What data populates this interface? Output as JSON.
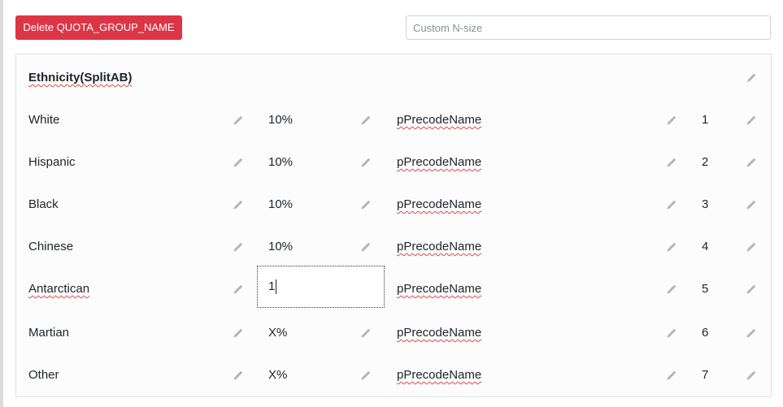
{
  "toolbar": {
    "delete_label": "Delete QUOTA_GROUP_NAME",
    "nsize_placeholder": "Custom N-size",
    "nsize_value": ""
  },
  "group": {
    "title": "Ethnicity(SplitAB)"
  },
  "rows": [
    {
      "name": "White",
      "percent": "10%",
      "precode": "pPrecodeName",
      "index": "1"
    },
    {
      "name": "Hispanic",
      "percent": "10%",
      "precode": "pPrecodeName",
      "index": "2"
    },
    {
      "name": "Black",
      "percent": "10%",
      "precode": "pPrecodeName",
      "index": "3"
    },
    {
      "name": "Chinese",
      "percent": "10%",
      "precode": "pPrecodeName",
      "index": "4"
    },
    {
      "name": "Antarctican",
      "percent": "1",
      "precode": "pPrecodeName",
      "index": "5",
      "editing": true
    },
    {
      "name": "Martian",
      "percent": "X%",
      "precode": "pPrecodeName",
      "index": "6"
    },
    {
      "name": "Other",
      "percent": "X%",
      "precode": "pPrecodeName",
      "index": "7"
    }
  ],
  "colors": {
    "danger": "#dc3545",
    "pencil": "#b5b5b5",
    "spellcheck": "#e04848"
  },
  "icons": {
    "edit": "pencil-icon"
  }
}
